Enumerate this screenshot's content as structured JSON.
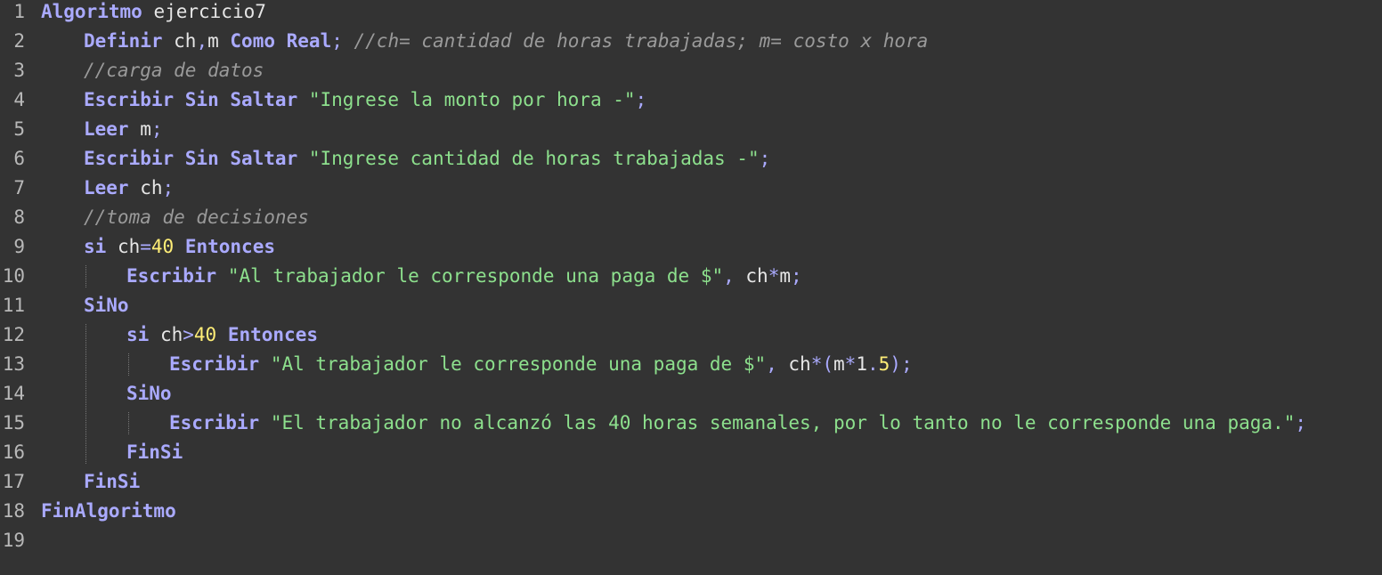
{
  "colors": {
    "background": "#333333",
    "keyword": "#aaaaff",
    "string": "#8de08d",
    "comment": "#9a9a9a",
    "number": "#ffee77",
    "identifier": "#e6e6e6",
    "line_number": "#b8b8b8"
  },
  "lines": [
    {
      "n": "1",
      "indent": 0,
      "tokens": [
        {
          "t": "kw",
          "v": "Algoritmo"
        },
        {
          "t": "id",
          "v": " ejercicio7"
        }
      ]
    },
    {
      "n": "2",
      "indent": 1,
      "tokens": [
        {
          "t": "kw",
          "v": "Definir"
        },
        {
          "t": "id",
          "v": " ch"
        },
        {
          "t": "punct",
          "v": ","
        },
        {
          "t": "id",
          "v": "m "
        },
        {
          "t": "kw",
          "v": "Como"
        },
        {
          "t": "id",
          "v": " "
        },
        {
          "t": "kw",
          "v": "Real"
        },
        {
          "t": "punct",
          "v": ";"
        },
        {
          "t": "com",
          "v": " //ch= cantidad de horas trabajadas; m= costo x hora"
        }
      ]
    },
    {
      "n": "3",
      "indent": 1,
      "tokens": [
        {
          "t": "com",
          "v": "//carga de datos"
        }
      ]
    },
    {
      "n": "4",
      "indent": 1,
      "tokens": [
        {
          "t": "kw",
          "v": "Escribir Sin Saltar"
        },
        {
          "t": "id",
          "v": " "
        },
        {
          "t": "str",
          "v": "\"Ingrese la monto por hora -\""
        },
        {
          "t": "punct",
          "v": ";"
        }
      ]
    },
    {
      "n": "5",
      "indent": 1,
      "tokens": [
        {
          "t": "kw",
          "v": "Leer"
        },
        {
          "t": "id",
          "v": " m"
        },
        {
          "t": "punct",
          "v": ";"
        }
      ]
    },
    {
      "n": "6",
      "indent": 1,
      "tokens": [
        {
          "t": "kw",
          "v": "Escribir Sin Saltar"
        },
        {
          "t": "id",
          "v": " "
        },
        {
          "t": "str",
          "v": "\"Ingrese cantidad de horas trabajadas -\""
        },
        {
          "t": "punct",
          "v": ";"
        }
      ]
    },
    {
      "n": "7",
      "indent": 1,
      "tokens": [
        {
          "t": "kw",
          "v": "Leer"
        },
        {
          "t": "id",
          "v": " ch"
        },
        {
          "t": "punct",
          "v": ";"
        }
      ]
    },
    {
      "n": "8",
      "indent": 1,
      "tokens": [
        {
          "t": "com",
          "v": "//toma de decisiones"
        }
      ]
    },
    {
      "n": "9",
      "indent": 1,
      "tokens": [
        {
          "t": "kw",
          "v": "si"
        },
        {
          "t": "id",
          "v": " ch"
        },
        {
          "t": "op",
          "v": "="
        },
        {
          "t": "num",
          "v": "40"
        },
        {
          "t": "id",
          "v": " "
        },
        {
          "t": "kw",
          "v": "Entonces"
        }
      ]
    },
    {
      "n": "10",
      "indent": 2,
      "tokens": [
        {
          "t": "kw",
          "v": "Escribir"
        },
        {
          "t": "id",
          "v": " "
        },
        {
          "t": "str",
          "v": "\"Al trabajador le corresponde una paga de $\""
        },
        {
          "t": "punct",
          "v": ","
        },
        {
          "t": "id",
          "v": " ch"
        },
        {
          "t": "op",
          "v": "*"
        },
        {
          "t": "id",
          "v": "m"
        },
        {
          "t": "punct",
          "v": ";"
        }
      ]
    },
    {
      "n": "11",
      "indent": 1,
      "tokens": [
        {
          "t": "kw",
          "v": "SiNo"
        }
      ]
    },
    {
      "n": "12",
      "indent": 2,
      "tokens": [
        {
          "t": "kw",
          "v": "si"
        },
        {
          "t": "id",
          "v": " ch"
        },
        {
          "t": "op",
          "v": ">"
        },
        {
          "t": "num",
          "v": "40"
        },
        {
          "t": "id",
          "v": " "
        },
        {
          "t": "kw",
          "v": "Entonces"
        }
      ]
    },
    {
      "n": "13",
      "indent": 3,
      "tokens": [
        {
          "t": "kw",
          "v": "Escribir"
        },
        {
          "t": "id",
          "v": " "
        },
        {
          "t": "str",
          "v": "\"Al trabajador le corresponde una paga de $\""
        },
        {
          "t": "punct",
          "v": ","
        },
        {
          "t": "id",
          "v": " ch"
        },
        {
          "t": "op",
          "v": "*("
        },
        {
          "t": "id",
          "v": "m"
        },
        {
          "t": "op",
          "v": "*"
        },
        {
          "t": "id",
          "v": "1"
        },
        {
          "t": "punct",
          "v": "."
        },
        {
          "t": "num",
          "v": "5"
        },
        {
          "t": "op",
          "v": ")"
        },
        {
          "t": "punct",
          "v": ";"
        }
      ]
    },
    {
      "n": "14",
      "indent": 2,
      "tokens": [
        {
          "t": "kw",
          "v": "SiNo"
        }
      ]
    },
    {
      "n": "15",
      "indent": 3,
      "tokens": [
        {
          "t": "kw",
          "v": "Escribir"
        },
        {
          "t": "id",
          "v": " "
        },
        {
          "t": "str",
          "v": "\"El trabajador no alcanzó las 40 horas semanales, por lo tanto no le corresponde una paga.\""
        },
        {
          "t": "punct",
          "v": ";"
        }
      ]
    },
    {
      "n": "16",
      "indent": 2,
      "tokens": [
        {
          "t": "kw",
          "v": "FinSi"
        }
      ]
    },
    {
      "n": "17",
      "indent": 1,
      "tokens": [
        {
          "t": "kw",
          "v": "FinSi"
        }
      ]
    },
    {
      "n": "18",
      "indent": 0,
      "tokens": [
        {
          "t": "kw",
          "v": "FinAlgoritmo"
        }
      ]
    },
    {
      "n": "19",
      "indent": 0,
      "tokens": []
    }
  ]
}
